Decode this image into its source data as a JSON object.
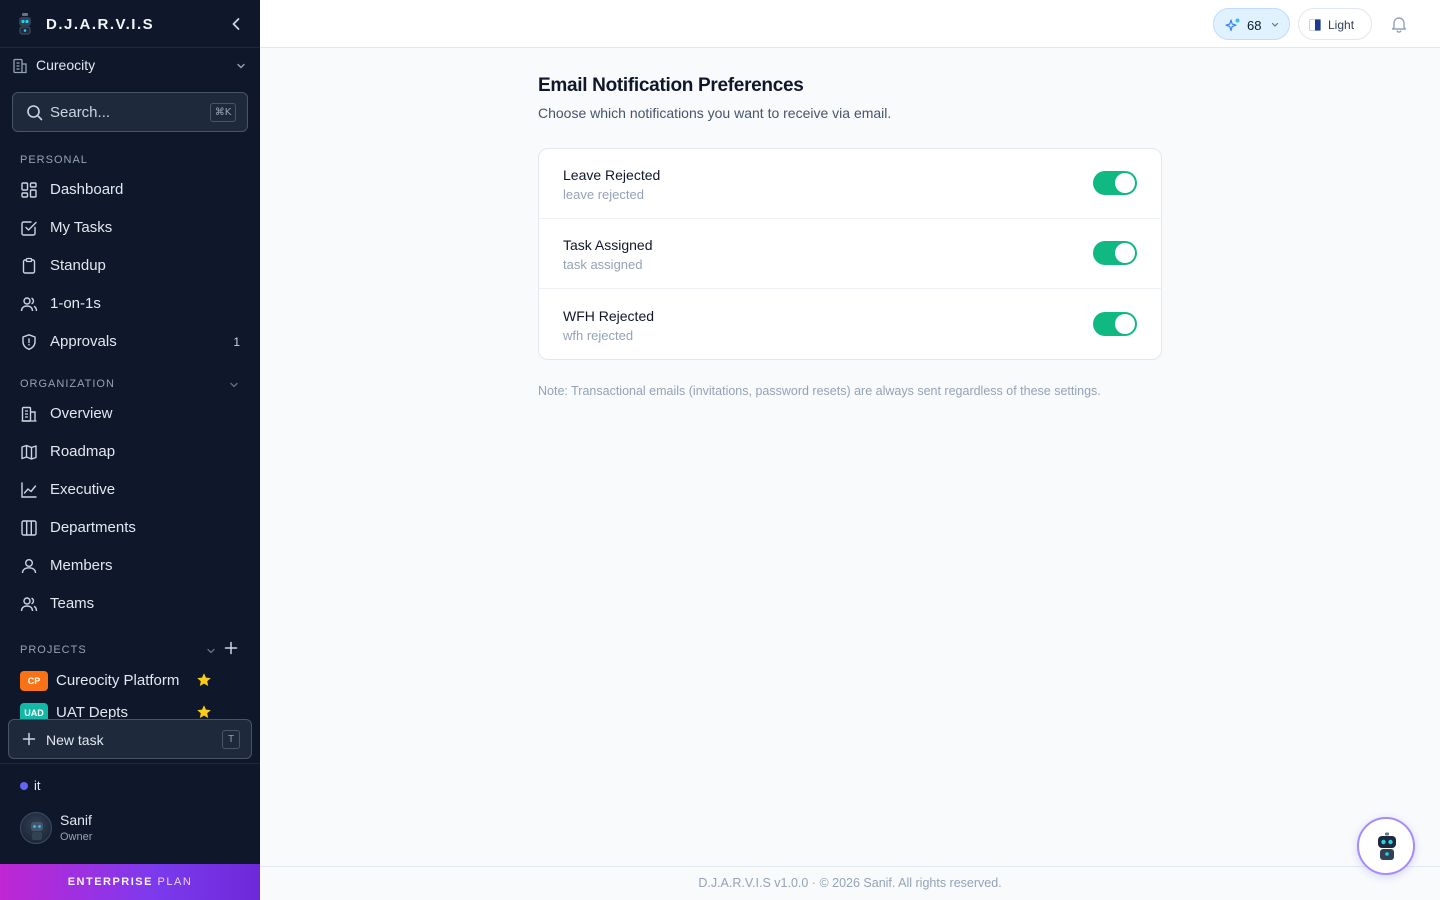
{
  "app": {
    "name": "D.J.A.R.V.I.S"
  },
  "org": {
    "name": "Cureocity"
  },
  "search": {
    "placeholder": "Search...",
    "shortcut": "⌘K"
  },
  "sections": {
    "personal": "PERSONAL",
    "organization": "ORGANIZATION",
    "projects": "PROJECTS"
  },
  "nav": {
    "personal": [
      {
        "label": "Dashboard",
        "icon": "grid-icon"
      },
      {
        "label": "My Tasks",
        "icon": "checkbox-icon"
      },
      {
        "label": "Standup",
        "icon": "clipboard-icon"
      },
      {
        "label": "1-on-1s",
        "icon": "users-icon"
      },
      {
        "label": "Approvals",
        "icon": "shield-icon",
        "count": "1"
      }
    ],
    "organization": [
      {
        "label": "Overview",
        "icon": "building-icon"
      },
      {
        "label": "Roadmap",
        "icon": "map-icon"
      },
      {
        "label": "Executive",
        "icon": "chart-line-icon"
      },
      {
        "label": "Departments",
        "icon": "columns-icon"
      },
      {
        "label": "Members",
        "icon": "user-icon"
      },
      {
        "label": "Teams",
        "icon": "users-icon"
      }
    ]
  },
  "projects": [
    {
      "badge": "CP",
      "label": "Cureocity Platform",
      "color": "#f97316"
    },
    {
      "badge": "UAD",
      "label": "UAT Depts",
      "color": "#14b8a6"
    }
  ],
  "new_task": {
    "label": "New task",
    "shortcut": "T"
  },
  "status": {
    "label": "it"
  },
  "user": {
    "name": "Sanif",
    "role": "Owner"
  },
  "plan": {
    "tier": "ENTERPRISE",
    "suffix": "PLAN"
  },
  "topbar": {
    "streak_count": "68",
    "theme_label": "Light"
  },
  "page": {
    "title": "Email Notification Preferences",
    "subtitle": "Choose which notifications you want to receive via email."
  },
  "preferences": [
    {
      "title": "Leave Rejected",
      "description": "leave rejected",
      "enabled": true
    },
    {
      "title": "Task Assigned",
      "description": "task assigned",
      "enabled": true
    },
    {
      "title": "WFH Rejected",
      "description": "wfh rejected",
      "enabled": true
    }
  ],
  "note": "Note: Transactional emails (invitations, password resets) are always sent regardless of these settings.",
  "footer": "D.J.A.R.V.I.S v1.0.0 · © 2026 Sanif. All rights reserved.",
  "colors": {
    "sidebar_bg": "#0f172a",
    "toggle_on": "#10b981",
    "accent": "#7c3aed"
  }
}
